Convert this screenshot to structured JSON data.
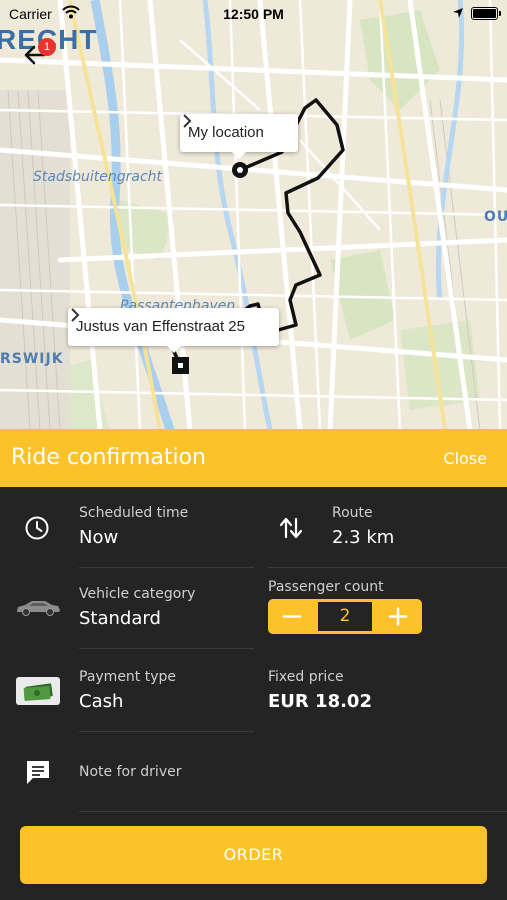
{
  "status_bar": {
    "carrier": "Carrier",
    "time": "12:50 PM"
  },
  "map": {
    "city_title": "RECHT",
    "badge_count": "1",
    "labels": {
      "canal": "Stadsbuitengracht",
      "harbour": "Passantenhaven",
      "district_left": "RSWIJK",
      "district_right": "OU"
    },
    "callouts": {
      "pickup": "My location",
      "destination": "Justus van Effenstraat 25"
    }
  },
  "sheet": {
    "title": "Ride confirmation",
    "close_label": "Close",
    "scheduled_time": {
      "label": "Scheduled time",
      "value": "Now"
    },
    "route": {
      "label": "Route",
      "value": "2.3 km"
    },
    "vehicle_category": {
      "label": "Vehicle category",
      "value": "Standard"
    },
    "passenger_count": {
      "label": "Passenger count",
      "value": "2"
    },
    "payment_type": {
      "label": "Payment type",
      "value": "Cash"
    },
    "fixed_price": {
      "label": "Fixed price",
      "value": "EUR 18.02"
    },
    "note": {
      "label": "Note for driver"
    },
    "order_label": "ORDER"
  },
  "colors": {
    "accent": "#fcc22a",
    "sheet_background": "#242424",
    "route_line": "#111111",
    "badge": "#e8342c"
  },
  "icons": {
    "back": "arrow-left-icon",
    "schedule": "clock-icon",
    "route": "swap-arrows-icon",
    "vehicle": "car-icon",
    "payment": "cash-icon",
    "note": "message-icon",
    "pickup_marker": "pickup-pin-icon",
    "destination_marker": "destination-pin-icon"
  }
}
